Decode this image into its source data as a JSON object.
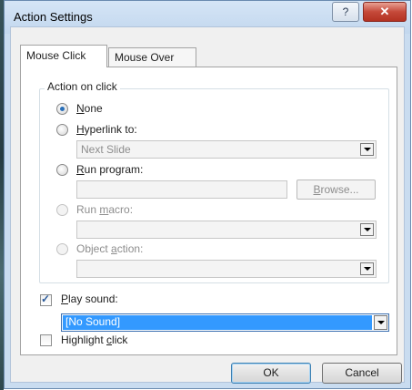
{
  "window": {
    "title": "Action Settings",
    "help_glyph": "?",
    "close_glyph": "✕"
  },
  "tabs": [
    {
      "label": "Mouse Click",
      "active": true
    },
    {
      "label": "Mouse Over",
      "active": false
    }
  ],
  "action_group": {
    "label": "Action on click",
    "options": {
      "none": {
        "prefix": "",
        "mnemonic": "N",
        "suffix": "one",
        "checked": true,
        "enabled": true
      },
      "hyperlink": {
        "prefix": "",
        "mnemonic": "H",
        "suffix": "yperlink to:",
        "checked": false,
        "enabled": true
      },
      "run_program": {
        "prefix": "",
        "mnemonic": "R",
        "suffix": "un program:",
        "checked": false,
        "enabled": true
      },
      "run_macro": {
        "prefix": "Run ",
        "mnemonic": "m",
        "suffix": "acro:",
        "checked": false,
        "enabled": false
      },
      "object_action": {
        "prefix": "Object ",
        "mnemonic": "a",
        "suffix": "ction:",
        "checked": false,
        "enabled": false
      }
    },
    "hyperlink_value": "Next Slide",
    "program_value": "",
    "browse_button": {
      "mnemonic": "B",
      "suffix": "rowse..."
    },
    "macro_value": "",
    "object_action_value": ""
  },
  "play_sound": {
    "mnemonic": "P",
    "suffix": "lay sound:",
    "checked": true,
    "value": "[No Sound]"
  },
  "highlight_click": {
    "prefix": "Highlight ",
    "mnemonic": "c",
    "suffix": "lick",
    "checked": false
  },
  "buttons": {
    "ok": "OK",
    "cancel": "Cancel"
  },
  "colors": {
    "selection": "#3399ff",
    "titlebar": "#c9dcf0",
    "close": "#c5493a"
  }
}
